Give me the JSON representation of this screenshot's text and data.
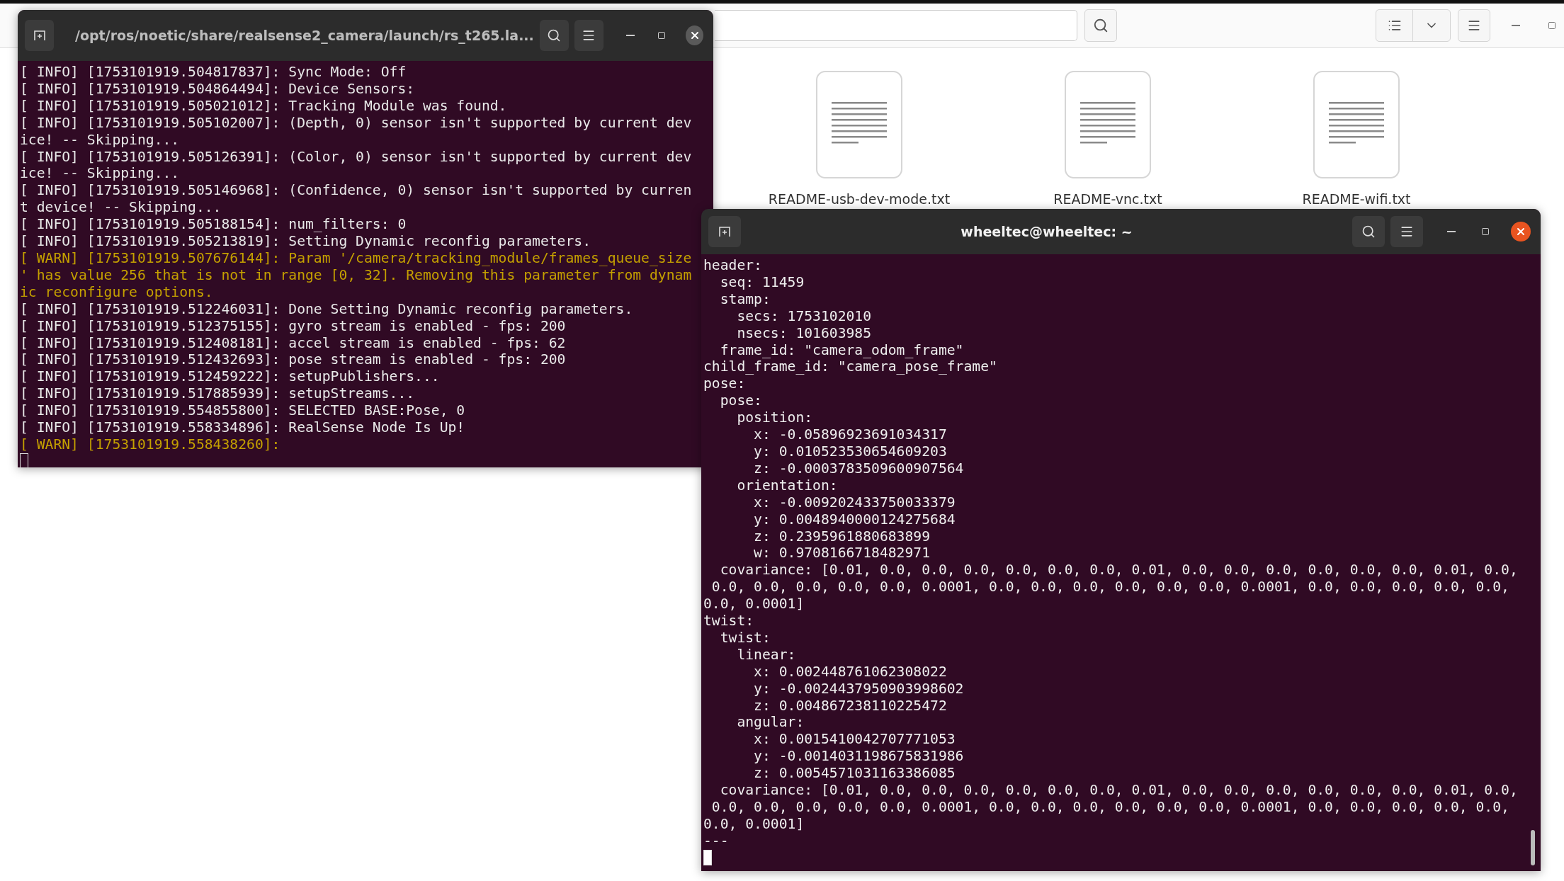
{
  "file_manager": {
    "files": [
      {
        "name": "README-usb-dev-mode.txt"
      },
      {
        "name": "README-vnc.txt"
      },
      {
        "name": "README-wifi.txt"
      }
    ]
  },
  "terminals": [
    {
      "title": "/opt/ros/noetic/share/realsense2_camera/launch/rs_t265.la...",
      "focused": false,
      "lines": [
        {
          "kind": "info",
          "text": "[ INFO] [1753101919.504817837]: Sync Mode: Off"
        },
        {
          "kind": "info",
          "text": "[ INFO] [1753101919.504864494]: Device Sensors:"
        },
        {
          "kind": "info",
          "text": "[ INFO] [1753101919.505021012]: Tracking Module was found."
        },
        {
          "kind": "info",
          "text": "[ INFO] [1753101919.505102007]: (Depth, 0) sensor isn't supported by current dev"
        },
        {
          "kind": "info",
          "text": "ice! -- Skipping..."
        },
        {
          "kind": "info",
          "text": "[ INFO] [1753101919.505126391]: (Color, 0) sensor isn't supported by current dev"
        },
        {
          "kind": "info",
          "text": "ice! -- Skipping..."
        },
        {
          "kind": "info",
          "text": "[ INFO] [1753101919.505146968]: (Confidence, 0) sensor isn't supported by curren"
        },
        {
          "kind": "info",
          "text": "t device! -- Skipping..."
        },
        {
          "kind": "info",
          "text": "[ INFO] [1753101919.505188154]: num_filters: 0"
        },
        {
          "kind": "info",
          "text": "[ INFO] [1753101919.505213819]: Setting Dynamic reconfig parameters."
        },
        {
          "kind": "warn",
          "text": "[ WARN] [1753101919.507676144]: Param '/camera/tracking_module/frames_queue_size"
        },
        {
          "kind": "warn",
          "text": "' has value 256 that is not in range [0, 32]. Removing this parameter from dynam"
        },
        {
          "kind": "warn",
          "text": "ic reconfigure options."
        },
        {
          "kind": "info",
          "text": "[ INFO] [1753101919.512246031]: Done Setting Dynamic reconfig parameters."
        },
        {
          "kind": "info",
          "text": "[ INFO] [1753101919.512375155]: gyro stream is enabled - fps: 200"
        },
        {
          "kind": "info",
          "text": "[ INFO] [1753101919.512408181]: accel stream is enabled - fps: 62"
        },
        {
          "kind": "info",
          "text": "[ INFO] [1753101919.512432693]: pose stream is enabled - fps: 200"
        },
        {
          "kind": "info",
          "text": "[ INFO] [1753101919.512459222]: setupPublishers..."
        },
        {
          "kind": "info",
          "text": "[ INFO] [1753101919.517885939]: setupStreams..."
        },
        {
          "kind": "info",
          "text": "[ INFO] [1753101919.554855800]: SELECTED BASE:Pose, 0"
        },
        {
          "kind": "info",
          "text": "[ INFO] [1753101919.558334896]: RealSense Node Is Up!"
        },
        {
          "kind": "warn",
          "text": "[ WARN] [1753101919.558438260]:"
        }
      ]
    },
    {
      "title": "wheeltec@wheeltec: ~",
      "focused": true,
      "lines": [
        {
          "kind": "output",
          "text": "header:"
        },
        {
          "kind": "output",
          "text": "  seq: 11459"
        },
        {
          "kind": "output",
          "text": "  stamp:"
        },
        {
          "kind": "output",
          "text": "    secs: 1753102010"
        },
        {
          "kind": "output",
          "text": "    nsecs: 101603985"
        },
        {
          "kind": "output",
          "text": "  frame_id: \"camera_odom_frame\""
        },
        {
          "kind": "output",
          "text": "child_frame_id: \"camera_pose_frame\""
        },
        {
          "kind": "output",
          "text": "pose:"
        },
        {
          "kind": "output",
          "text": "  pose:"
        },
        {
          "kind": "output",
          "text": "    position:"
        },
        {
          "kind": "output",
          "text": "      x: -0.05896923691034317"
        },
        {
          "kind": "output",
          "text": "      y: 0.010523530654609203"
        },
        {
          "kind": "output",
          "text": "      z: -0.0003783509600907564"
        },
        {
          "kind": "output",
          "text": "    orientation:"
        },
        {
          "kind": "output",
          "text": "      x: -0.009202433750033379"
        },
        {
          "kind": "output",
          "text": "      y: 0.0048940000124275684"
        },
        {
          "kind": "output",
          "text": "      z: 0.2395961880683899"
        },
        {
          "kind": "output",
          "text": "      w: 0.9708166718482971"
        },
        {
          "kind": "output",
          "text": "  covariance: [0.01, 0.0, 0.0, 0.0, 0.0, 0.0, 0.0, 0.01, 0.0, 0.0, 0.0, 0.0, 0.0, 0.0, 0.01, 0.0,"
        },
        {
          "kind": "output",
          "text": " 0.0, 0.0, 0.0, 0.0, 0.0, 0.0001, 0.0, 0.0, 0.0, 0.0, 0.0, 0.0, 0.0001, 0.0, 0.0, 0.0, 0.0, 0.0,"
        },
        {
          "kind": "output",
          "text": "0.0, 0.0001]"
        },
        {
          "kind": "output",
          "text": "twist:"
        },
        {
          "kind": "output",
          "text": "  twist:"
        },
        {
          "kind": "output",
          "text": "    linear:"
        },
        {
          "kind": "output",
          "text": "      x: 0.002448761062308022"
        },
        {
          "kind": "output",
          "text": "      y: -0.0024437950903998602"
        },
        {
          "kind": "output",
          "text": "      z: 0.004867238110225472"
        },
        {
          "kind": "output",
          "text": "    angular:"
        },
        {
          "kind": "output",
          "text": "      x: 0.0015410042707771053"
        },
        {
          "kind": "output",
          "text": "      y: -0.0014031198675831986"
        },
        {
          "kind": "output",
          "text": "      z: 0.0054571031163386085"
        },
        {
          "kind": "output",
          "text": "  covariance: [0.01, 0.0, 0.0, 0.0, 0.0, 0.0, 0.0, 0.01, 0.0, 0.0, 0.0, 0.0, 0.0, 0.0, 0.01, 0.0,"
        },
        {
          "kind": "output",
          "text": " 0.0, 0.0, 0.0, 0.0, 0.0, 0.0001, 0.0, 0.0, 0.0, 0.0, 0.0, 0.0, 0.0001, 0.0, 0.0, 0.0, 0.0, 0.0,"
        },
        {
          "kind": "output",
          "text": "0.0, 0.0001]"
        },
        {
          "kind": "output",
          "text": "---"
        }
      ]
    }
  ]
}
